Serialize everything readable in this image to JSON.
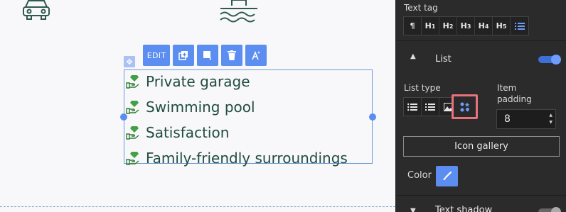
{
  "canvas": {
    "car_caption": "",
    "toolbar": {
      "edit_label": "EDIT",
      "buttons": [
        "duplicate-icon",
        "layer-icon",
        "delete-icon",
        "ai-assist-icon"
      ]
    },
    "list_items": [
      {
        "text": "Private garage",
        "icon": "gem-hand-icon"
      },
      {
        "text": "Swimming pool",
        "icon": "gem-hand-icon"
      },
      {
        "text": "Satisfaction",
        "icon": "gem-hand-icon"
      },
      {
        "text": "Family-friendly surroundings",
        "icon": "gem-hand-icon"
      }
    ],
    "colors": {
      "list_text": "#1f4d3e",
      "icon_green": "#4caf50",
      "accent": "#5b8ef0"
    }
  },
  "panel": {
    "text_tag_label": "Text tag",
    "tag_buttons": [
      "¶",
      "H",
      "H",
      "H",
      "H",
      "H"
    ],
    "tag_nums": [
      "",
      "1",
      "2",
      "3",
      "4",
      "5"
    ],
    "list_heading": "List",
    "list_enabled": true,
    "list_type_label": "List type",
    "item_padding_label": "Item padding",
    "item_padding_value": "8",
    "icon_gallery_label": "Icon gallery",
    "color_label": "Color",
    "text_shadow_heading": "Text shadow",
    "text_shadow_enabled": false,
    "colors": {
      "bg": "#2b2b2b",
      "accent": "#5b8ef0",
      "highlight": "#e9727f"
    }
  }
}
